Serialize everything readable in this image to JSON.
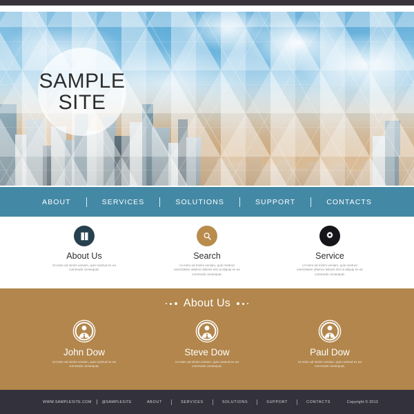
{
  "site": {
    "logo_line1": "SAMPLE",
    "logo_line2": "SITE"
  },
  "colors": {
    "topbar": "#38343a",
    "nav": "#4389a5",
    "about_band": "#b2864c",
    "footer": "#33323c",
    "icon_about": "#27404f",
    "icon_search": "#b98c4e",
    "icon_service": "#15151a"
  },
  "nav": {
    "items": [
      {
        "label": "ABOUT"
      },
      {
        "label": "SERVICES"
      },
      {
        "label": "SOLUTIONS"
      },
      {
        "label": "SUPPORT"
      },
      {
        "label": "CONTACTS"
      }
    ]
  },
  "services": {
    "columns": [
      {
        "icon": "book-icon",
        "title": "About Us",
        "body": "Ut enim ad minim veniam, quis nostrud ex ea commodo consequat."
      },
      {
        "icon": "search-icon",
        "title": "Search",
        "body": "Ut enim ad minim veniam, quis nostrud exercitation ullamco laboris nisi ut aliquip ex ea commodo consequat."
      },
      {
        "icon": "gear-icon",
        "title": "Service",
        "body": "Ut enim ad minim veniam, quis nostrud exercitation ullamco laboris nisi ut aliquip ex ea commodo consequat."
      }
    ]
  },
  "about": {
    "title": "About Us",
    "team": [
      {
        "name": "John Dow",
        "body": "Ut enim ad minim veniam, quis nostrud ex ea commodo consequat."
      },
      {
        "name": "Steve Dow",
        "body": "Ut enim ad minim veniam, quis nostrud ex ea commodo consequat."
      },
      {
        "name": "Paul Dow",
        "body": "Ut enim ad minim veniam, quis nostrud ex ea commodo consequat."
      }
    ]
  },
  "footer": {
    "website": "WWW.SAMPLESITE.COM",
    "social": "@SAMPLESITE",
    "links": [
      {
        "label": "ABOUT"
      },
      {
        "label": "SERVICES"
      },
      {
        "label": "SOLUTIONS"
      },
      {
        "label": "SUPPORT"
      },
      {
        "label": "CONTACTS"
      }
    ],
    "copyright": "Copyright © 2013"
  }
}
